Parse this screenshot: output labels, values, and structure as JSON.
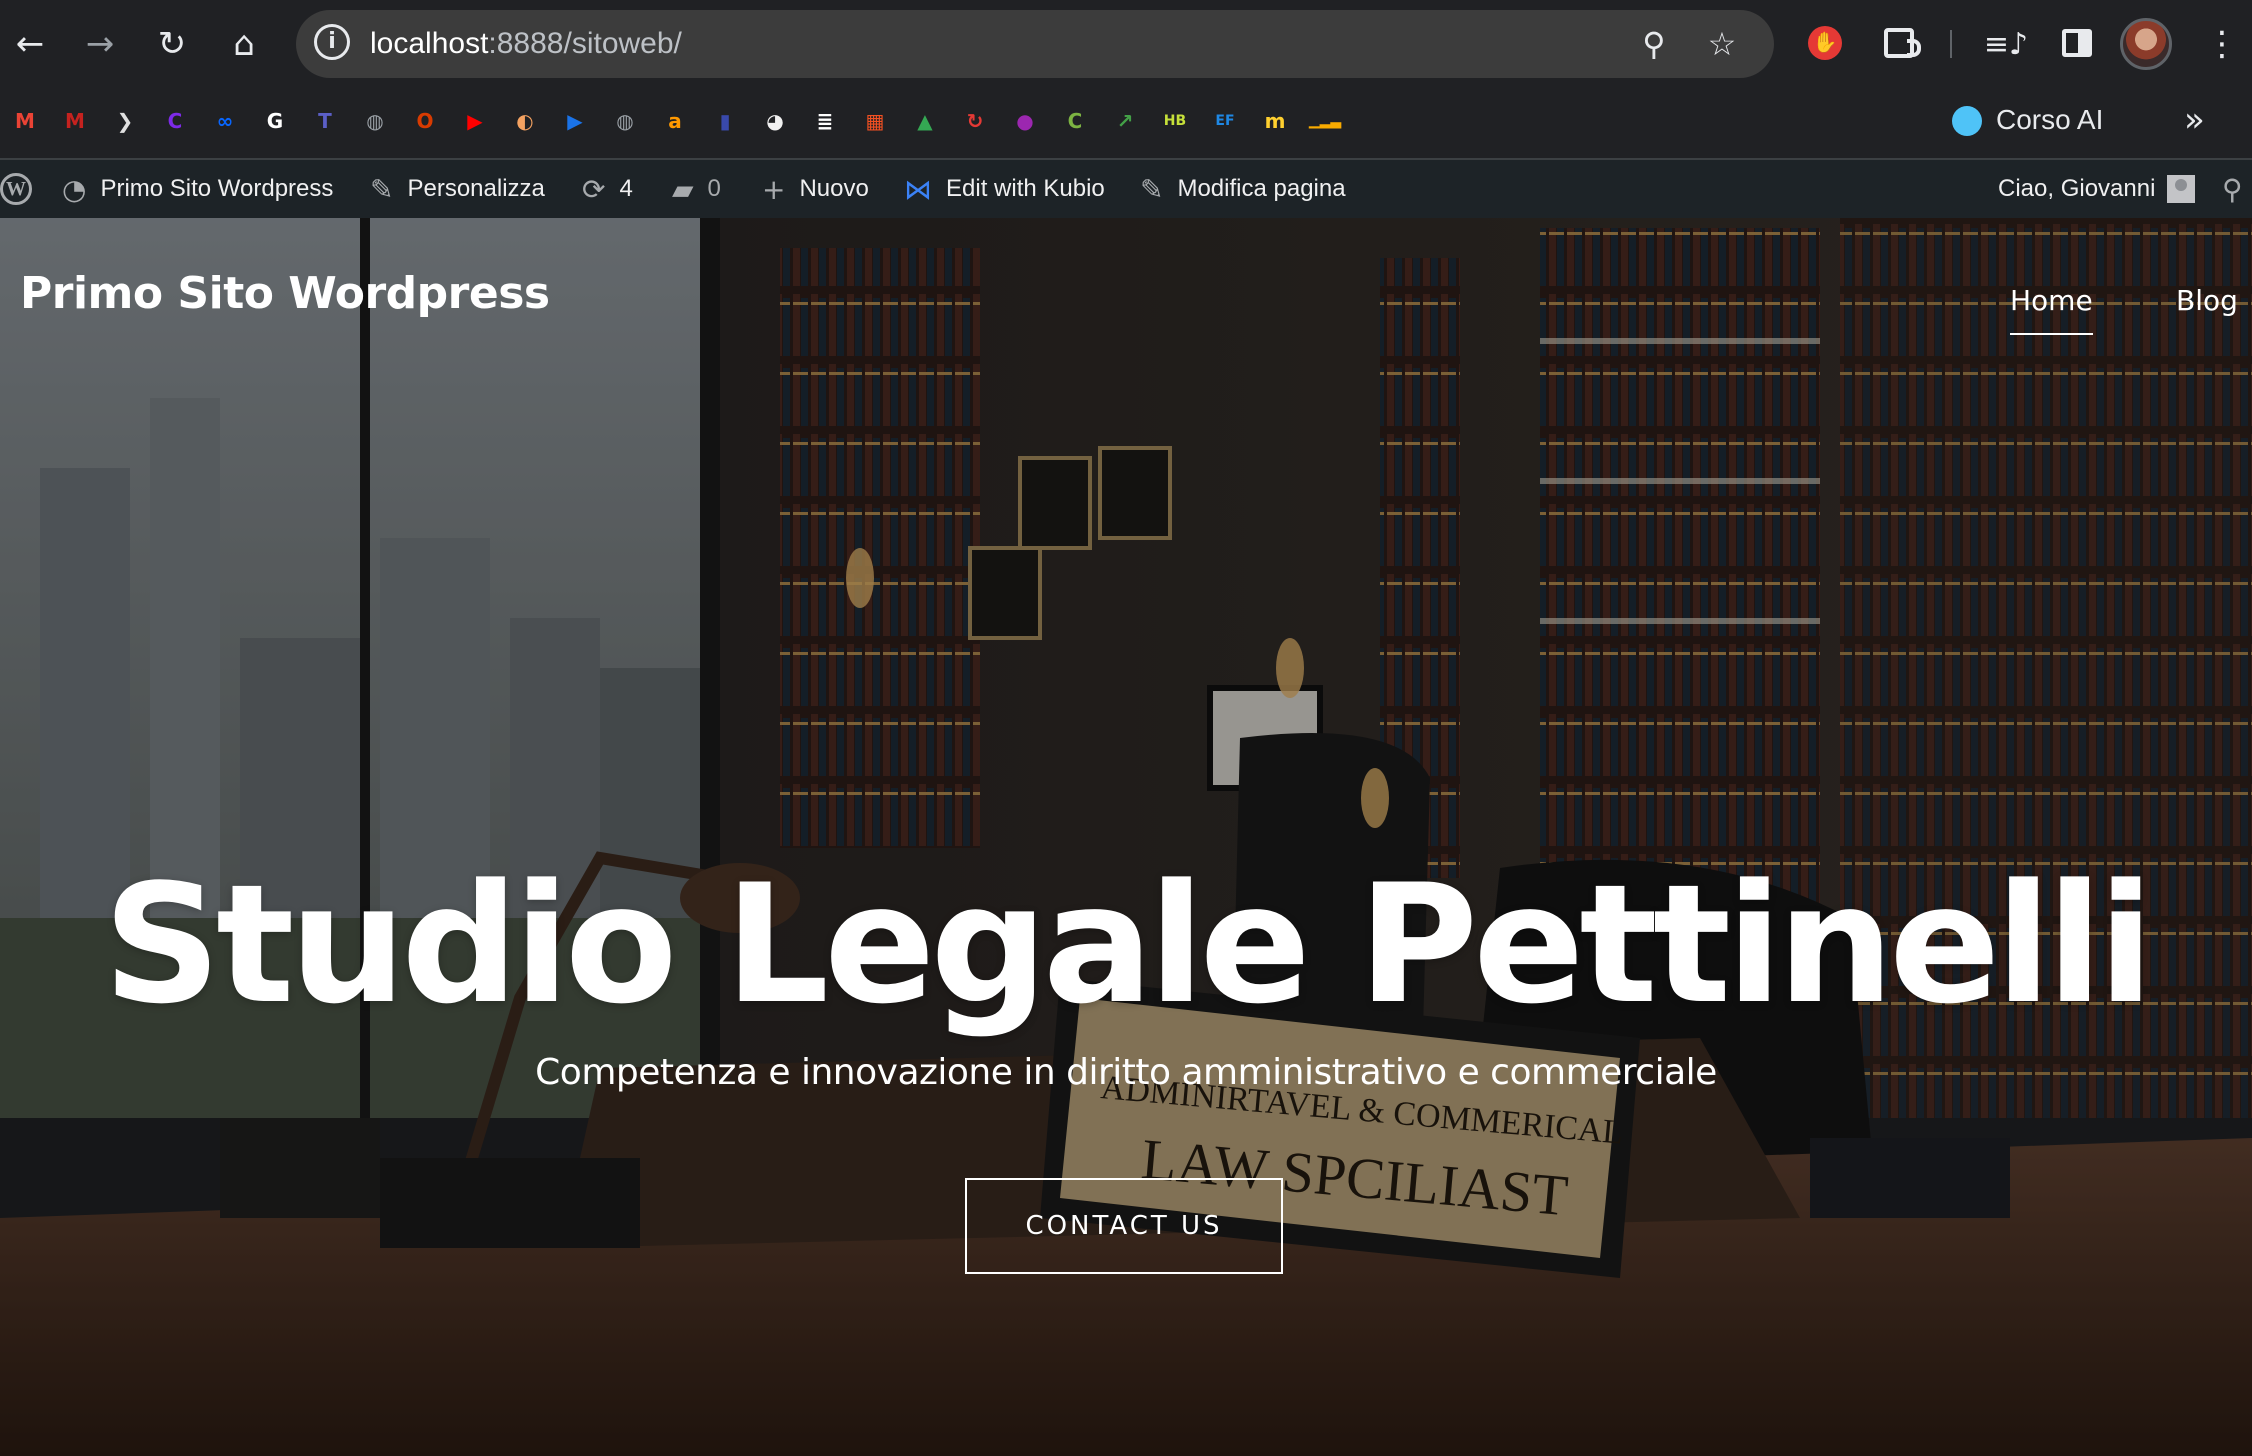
{
  "browser": {
    "url_host": "localhost",
    "url_path": ":8888/sitoweb/",
    "bookmarks": [
      {
        "name": "gmail-1",
        "glyph": "M",
        "color": "#ea4335"
      },
      {
        "name": "gmail-2",
        "glyph": "M",
        "color": "#c5221f"
      },
      {
        "name": "bookmark-3",
        "glyph": "❯",
        "color": "#e0e0e0"
      },
      {
        "name": "canva",
        "glyph": "C",
        "color": "#7d2ae8"
      },
      {
        "name": "meta",
        "glyph": "∞",
        "color": "#0866ff"
      },
      {
        "name": "google",
        "glyph": "G",
        "color": "#ffffff"
      },
      {
        "name": "teams",
        "glyph": "T",
        "color": "#5b5fc7"
      },
      {
        "name": "globe-1",
        "glyph": "◍",
        "color": "#9aa0a6"
      },
      {
        "name": "office",
        "glyph": "O",
        "color": "#d83b01"
      },
      {
        "name": "youtube",
        "glyph": "▶",
        "color": "#ff0000"
      },
      {
        "name": "bookmark-11",
        "glyph": "◐",
        "color": "#f4a261"
      },
      {
        "name": "play",
        "glyph": "▶",
        "color": "#1a73e8"
      },
      {
        "name": "globe-2",
        "glyph": "◍",
        "color": "#9aa0a6"
      },
      {
        "name": "amazon",
        "glyph": "a",
        "color": "#ff9900"
      },
      {
        "name": "bookmark-15",
        "glyph": "▮",
        "color": "#3949ab"
      },
      {
        "name": "bookmark-16",
        "glyph": "◕",
        "color": "#f1f1f1"
      },
      {
        "name": "bookmark-17",
        "glyph": "≣",
        "color": "#ffffff"
      },
      {
        "name": "microsoft",
        "glyph": "▦",
        "color": "#f25022"
      },
      {
        "name": "drive",
        "glyph": "▲",
        "color": "#34a853"
      },
      {
        "name": "bookmark-20",
        "glyph": "↻",
        "color": "#e53935"
      },
      {
        "name": "bookmark-21",
        "glyph": "●",
        "color": "#9c27b0"
      },
      {
        "name": "bookmark-22",
        "glyph": "C",
        "color": "#7cb342"
      },
      {
        "name": "bookmark-23",
        "glyph": "↗",
        "color": "#43a047"
      },
      {
        "name": "hb",
        "glyph": "HB",
        "color": "#c6e03a"
      },
      {
        "name": "ef",
        "glyph": "EF",
        "color": "#1e88e5"
      },
      {
        "name": "miro",
        "glyph": "m",
        "color": "#ffd02f"
      },
      {
        "name": "analytics",
        "glyph": "▁▂▃",
        "color": "#f9ab00"
      }
    ],
    "bookmark_label": "Corso AI"
  },
  "adminbar": {
    "site_name": "Primo Sito Wordpress",
    "customize": "Personalizza",
    "updates_count": "4",
    "comments_count": "0",
    "new": "Nuovo",
    "kubio": "Edit with Kubio",
    "edit_page": "Modifica pagina",
    "greeting": "Ciao, Giovanni"
  },
  "site": {
    "title": "Primo Sito Wordpress",
    "nav": [
      "Home",
      "Blog"
    ]
  },
  "hero": {
    "title": "Studio Legale Pettinelli",
    "subtitle": "Competenza e innovazione in diritto amministrativo e commerciale",
    "button": "CONTACT US",
    "nameplate_line1": "ADMINIRTAVEL & COMMERICAL",
    "nameplate_line2": "LAW SPCILIAST"
  }
}
